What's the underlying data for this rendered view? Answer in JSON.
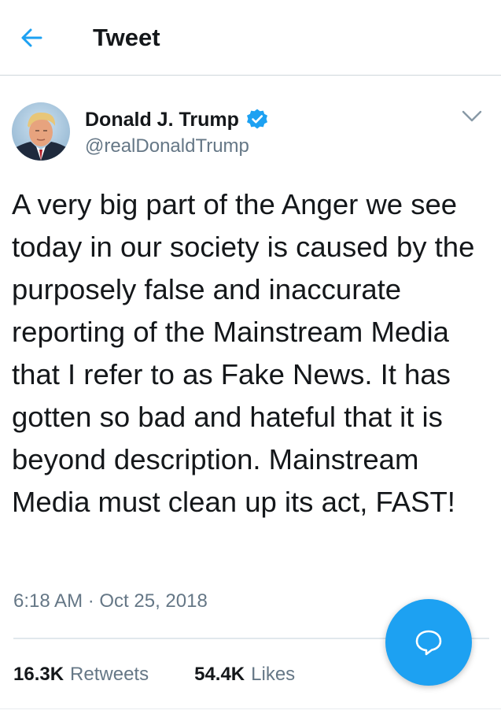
{
  "header": {
    "title": "Tweet",
    "back_icon": "arrow-left-icon"
  },
  "tweet": {
    "author": {
      "display_name": "Donald J. Trump",
      "handle": "@realDonaldTrump",
      "verified": true,
      "verified_icon": "verified-badge-icon"
    },
    "menu_icon": "chevron-down-icon",
    "text": "A very big part of the Anger we see today in our society is caused by the purposely false and inaccurate reporting of the Mainstream Media that I refer to as Fake News. It has gotten so bad and hateful that it is beyond description. Mainstream Media must clean up its act, FAST!",
    "timestamp": "6:18 AM · Oct 25, 2018",
    "stats": {
      "retweets_count": "16.3K",
      "retweets_label": "Retweets",
      "likes_count": "54.4K",
      "likes_label": "Likes"
    }
  },
  "fab": {
    "icon": "reply-bubble-icon"
  },
  "colors": {
    "accent": "#1da1f2",
    "text_primary": "#14171a",
    "text_secondary": "#657786",
    "divider": "#e1e8ed"
  }
}
